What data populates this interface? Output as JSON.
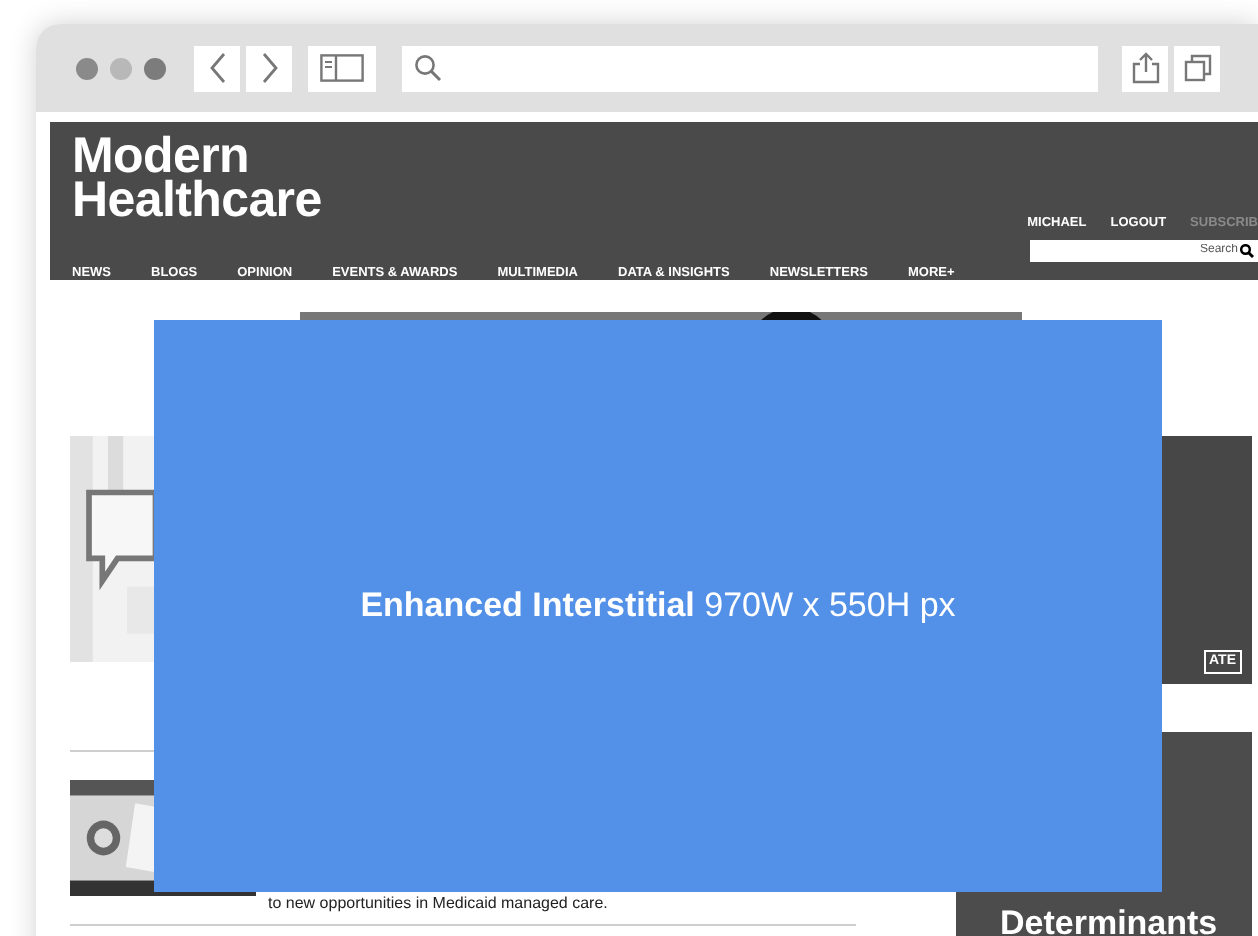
{
  "site": {
    "logo": [
      "Modern",
      "Healthcare"
    ],
    "nav": [
      "NEWS",
      "BLOGS",
      "OPINION",
      "EVENTS & AWARDS",
      "MULTIMEDIA",
      "DATA & INSIGHTS",
      "NEWSLETTERS",
      "MORE+"
    ],
    "user_links": [
      {
        "label": "MICHAEL",
        "disabled": false
      },
      {
        "label": "LOGOUT",
        "disabled": false
      },
      {
        "label": "SUBSCRIB",
        "disabled": true
      }
    ],
    "search": {
      "placeholder": "Search"
    }
  },
  "ad_button": "ATE",
  "article": {
    "snippet": "to new opportunities in Medicaid managed care."
  },
  "side_ad": {
    "lines": [
      "Determinants"
    ]
  },
  "interstitial": {
    "text": "**Enhanced Interstitial** 970W x 550H px"
  }
}
